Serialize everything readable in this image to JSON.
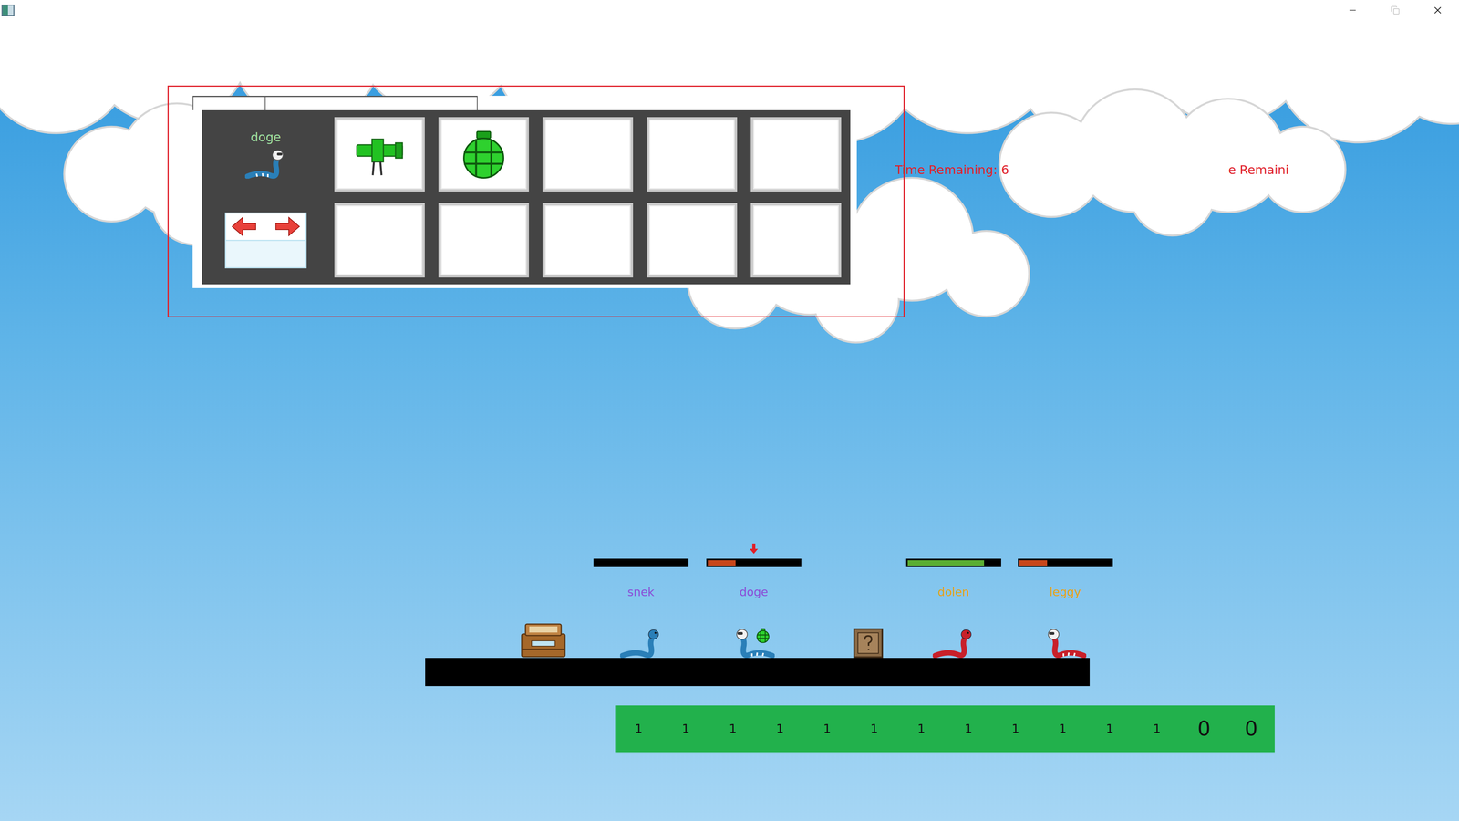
{
  "weapon_panel": {
    "worm_name": "doge",
    "slots": [
      {
        "kind": "bazooka"
      },
      {
        "kind": "grenade"
      },
      {
        "kind": "empty"
      },
      {
        "kind": "empty"
      },
      {
        "kind": "empty"
      },
      {
        "kind": "empty"
      },
      {
        "kind": "empty"
      },
      {
        "kind": "empty"
      },
      {
        "kind": "empty"
      },
      {
        "kind": "empty"
      }
    ]
  },
  "timers": [
    {
      "text": "Time Remaining: 6"
    },
    {
      "text": "e Remaini"
    }
  ],
  "worms": [
    {
      "name": "snek",
      "level": 0,
      "color": "#8a4fd8",
      "bar_color": "#c8471c",
      "body_color": "#2a7fb8",
      "kind": "snake",
      "facing": "right",
      "selected": false,
      "armed": false
    },
    {
      "name": "doge",
      "level": 0.3,
      "color": "#8a4fd8",
      "bar_color": "#c8471c",
      "body_color": "#2a7fb8",
      "kind": "robot",
      "facing": "left",
      "selected": true,
      "armed": true
    },
    {
      "name": "dolen",
      "level": 0.83,
      "color": "#e8a317",
      "bar_color": "#5aae32",
      "body_color": "#c8202a",
      "kind": "snake",
      "facing": "right",
      "selected": false,
      "armed": false
    },
    {
      "name": "leggy",
      "level": 0.3,
      "color": "#e8a317",
      "bar_color": "#c8471c",
      "body_color": "#c8202a",
      "kind": "robot",
      "facing": "left",
      "selected": false,
      "armed": false
    }
  ],
  "props": [
    {
      "kind": "chest"
    },
    {
      "kind": "mystery-box"
    }
  ],
  "counter": [
    {
      "text": "1",
      "kind": "small"
    },
    {
      "text": "1",
      "kind": "small"
    },
    {
      "text": "1",
      "kind": "small"
    },
    {
      "text": "1",
      "kind": "small"
    },
    {
      "text": "1",
      "kind": "small"
    },
    {
      "text": "1",
      "kind": "small"
    },
    {
      "text": "1",
      "kind": "small"
    },
    {
      "text": "1",
      "kind": "small"
    },
    {
      "text": "1",
      "kind": "small"
    },
    {
      "text": "1",
      "kind": "small"
    },
    {
      "text": "1",
      "kind": "small"
    },
    {
      "text": "1",
      "kind": "small"
    },
    {
      "text": "0",
      "kind": "large"
    },
    {
      "text": "0",
      "kind": "large"
    }
  ]
}
